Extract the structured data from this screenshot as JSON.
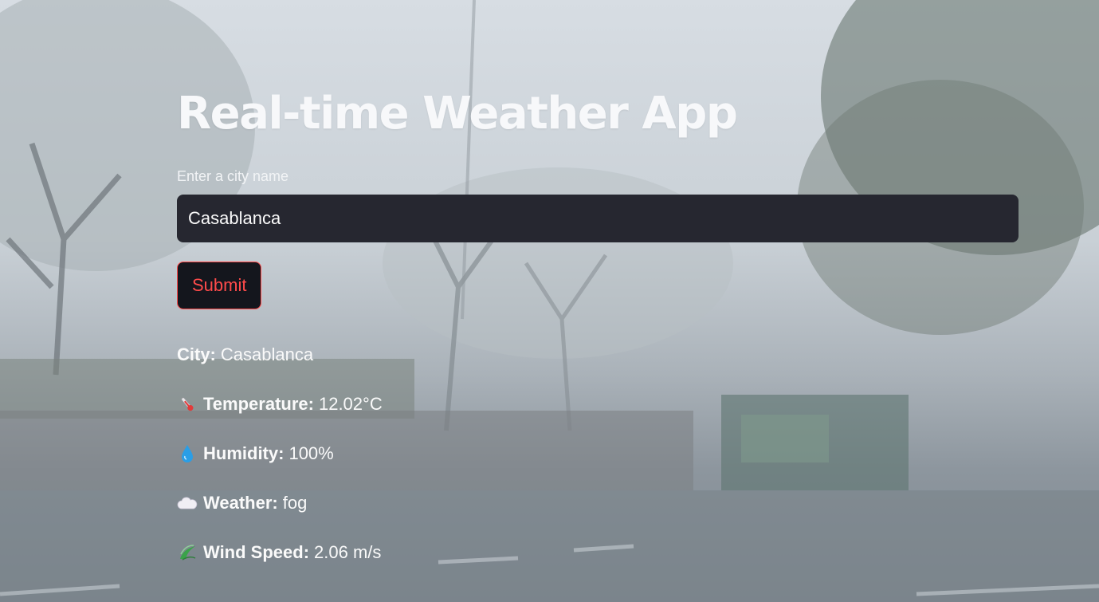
{
  "app": {
    "title": "Real-time Weather App"
  },
  "form": {
    "city_label": "Enter a city name",
    "city_value": "Casablanca",
    "submit_label": "Submit",
    "accent_color": "#ff4b4b",
    "input_bg": "#262730"
  },
  "results": {
    "city": {
      "label": "City:",
      "value": "Casablanca"
    },
    "temperature": {
      "icon": "thermometer-icon",
      "label": "Temperature:",
      "value": "12.02°C"
    },
    "humidity": {
      "icon": "droplet-icon",
      "label": "Humidity:",
      "value": "100%"
    },
    "weather": {
      "icon": "cloud-icon",
      "label": "Weather:",
      "value": "fog"
    },
    "wind": {
      "icon": "wind-icon",
      "label": "Wind Speed:",
      "value": "2.06 m/s"
    }
  }
}
